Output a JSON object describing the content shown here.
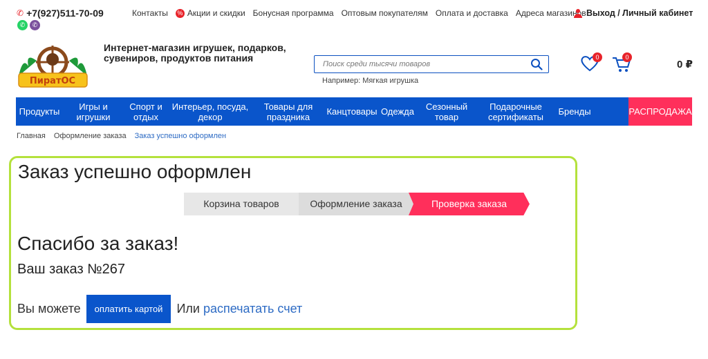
{
  "topbar": {
    "phone": "+7(927)511-70-09",
    "links": [
      "Контакты",
      "Акции и скидки",
      "Бонусная программа",
      "Оптовым покупателям",
      "Оплата и доставка",
      "Адреса магазинов"
    ],
    "account": "Выход / Личный кабинет"
  },
  "header": {
    "logo_text": "ПиратОС",
    "tagline_line1": "Интернет-магазин игрушек, подарков,",
    "tagline_line2": "сувениров, продуктов питания",
    "search_placeholder": "Поиск среди тысячи товаров",
    "search_example": "Например: Мягкая игрушка",
    "wishlist_count": "0",
    "cart_count": "0",
    "cart_total": "0 ₽"
  },
  "nav": [
    {
      "label": "Продукты",
      "w": 68
    },
    {
      "label": "Игры и игрушки",
      "w": 88
    },
    {
      "label": "Спорт и отдых",
      "w": 64
    },
    {
      "label": "Интерьер, посуда, декор",
      "w": 122
    },
    {
      "label": "Товары для праздника",
      "w": 104
    },
    {
      "label": "Канцтовары",
      "w": 80
    },
    {
      "label": "Одежда",
      "w": 52
    },
    {
      "label": "Сезонный товар",
      "w": 90
    },
    {
      "label": "Подарочные сертификаты",
      "w": 110
    },
    {
      "label": "Бренды",
      "w": 60
    },
    {
      "label": "РАСПРОДАЖА",
      "w": 92
    }
  ],
  "breadcrumb": [
    "Главная",
    "Оформление заказа",
    "Заказ успешно оформлен"
  ],
  "order": {
    "title": "Заказ успешно оформлен",
    "steps": [
      "Корзина товаров",
      "Оформление заказа",
      "Проверка заказа"
    ],
    "thanks": "Спасибо за заказ!",
    "order_number": "Ваш заказ №267",
    "you_can": "Вы можете",
    "pay_button": "оплатить картой",
    "or": "Или",
    "print_link": "распечатать счет"
  },
  "colors": {
    "accent_blue": "#0a55cb",
    "sale_red": "#ff2f5b",
    "panel_border": "#b4e13c"
  }
}
